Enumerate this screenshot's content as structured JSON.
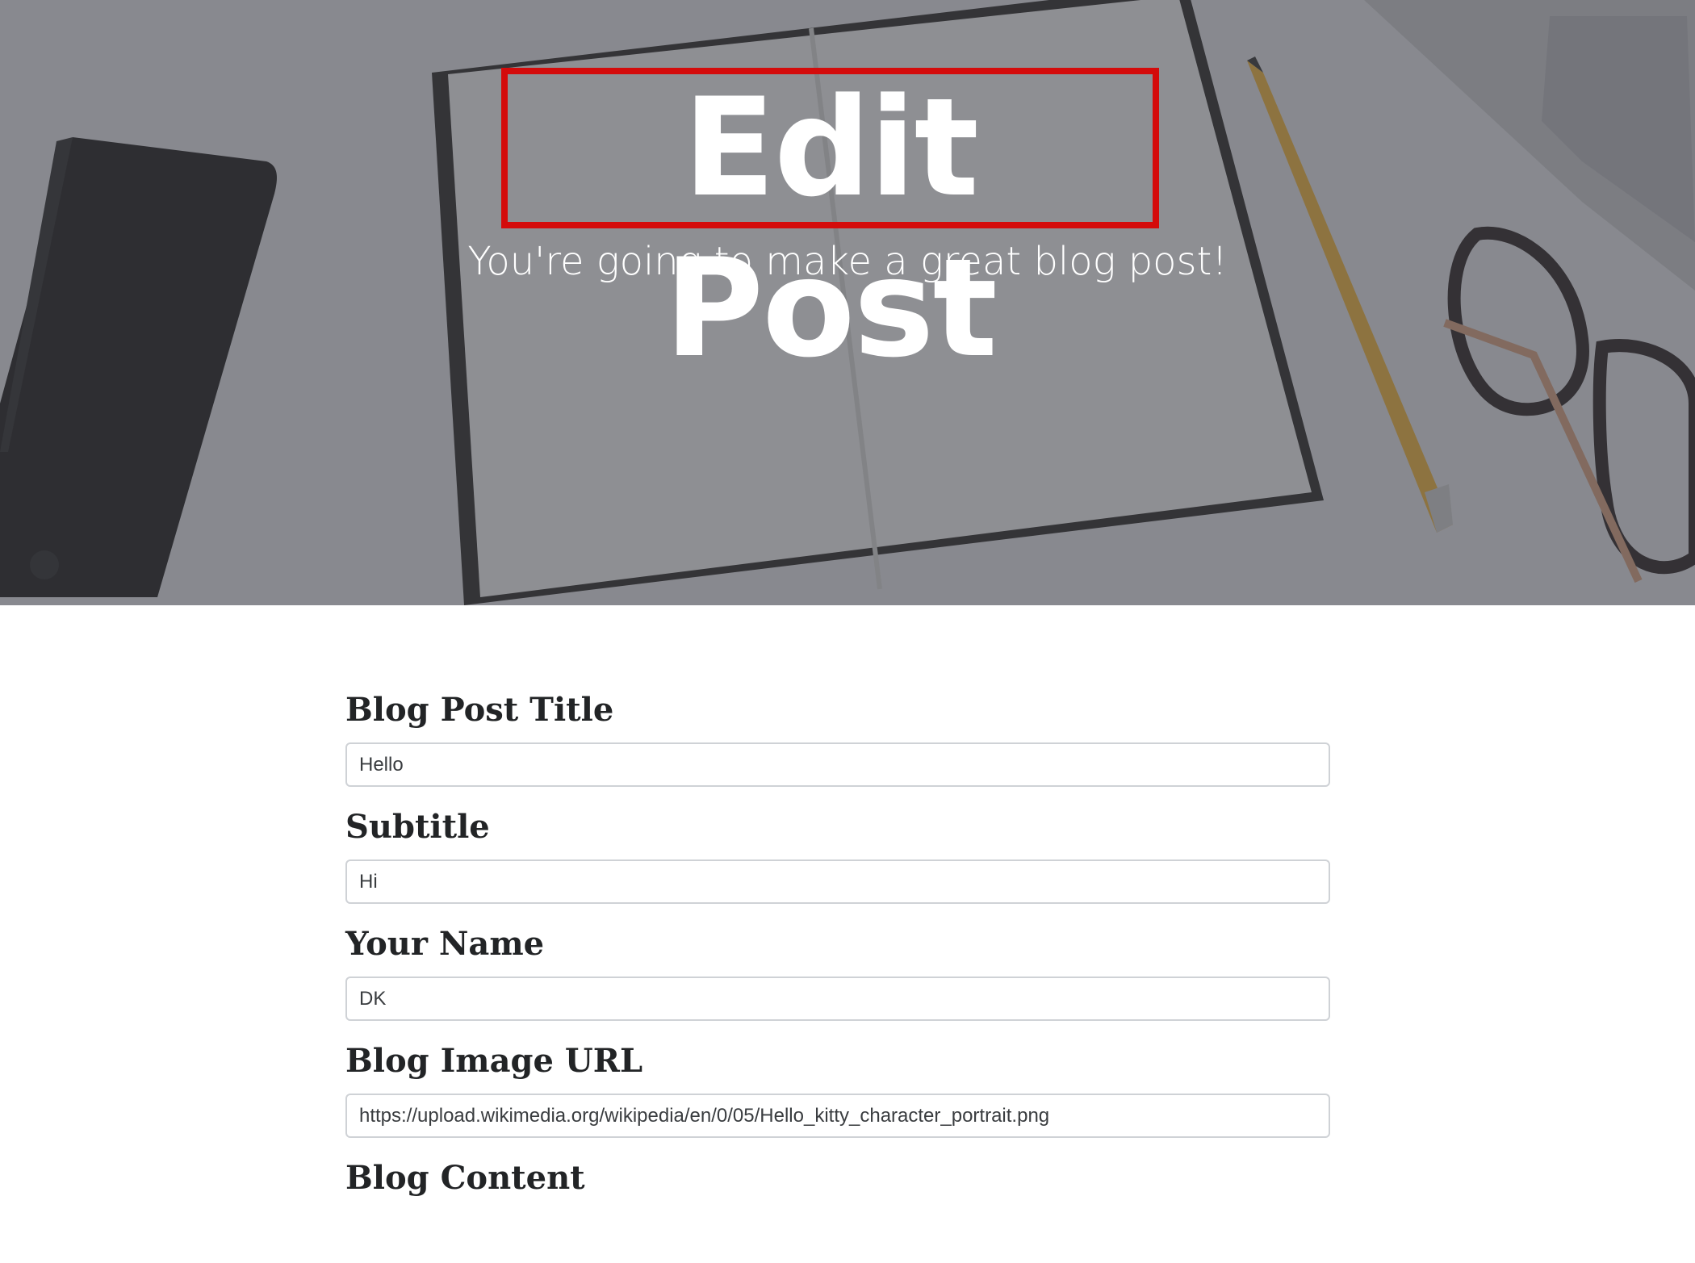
{
  "hero": {
    "title": "Edit Post",
    "subtitle": "You're going to make a great blog post!"
  },
  "form": {
    "fields": [
      {
        "label": "Blog Post Title",
        "value": "Hello"
      },
      {
        "label": "Subtitle",
        "value": "Hi"
      },
      {
        "label": "Your Name",
        "value": "DK"
      },
      {
        "label": "Blog Image URL",
        "value": "https://upload.wikimedia.org/wikipedia/en/0/05/Hello_kitty_character_portrait.png"
      },
      {
        "label": "Blog Content"
      }
    ]
  },
  "colors": {
    "highlight_box": "#d40b0b",
    "label_text": "#222426",
    "input_border": "#cfd2d6"
  }
}
